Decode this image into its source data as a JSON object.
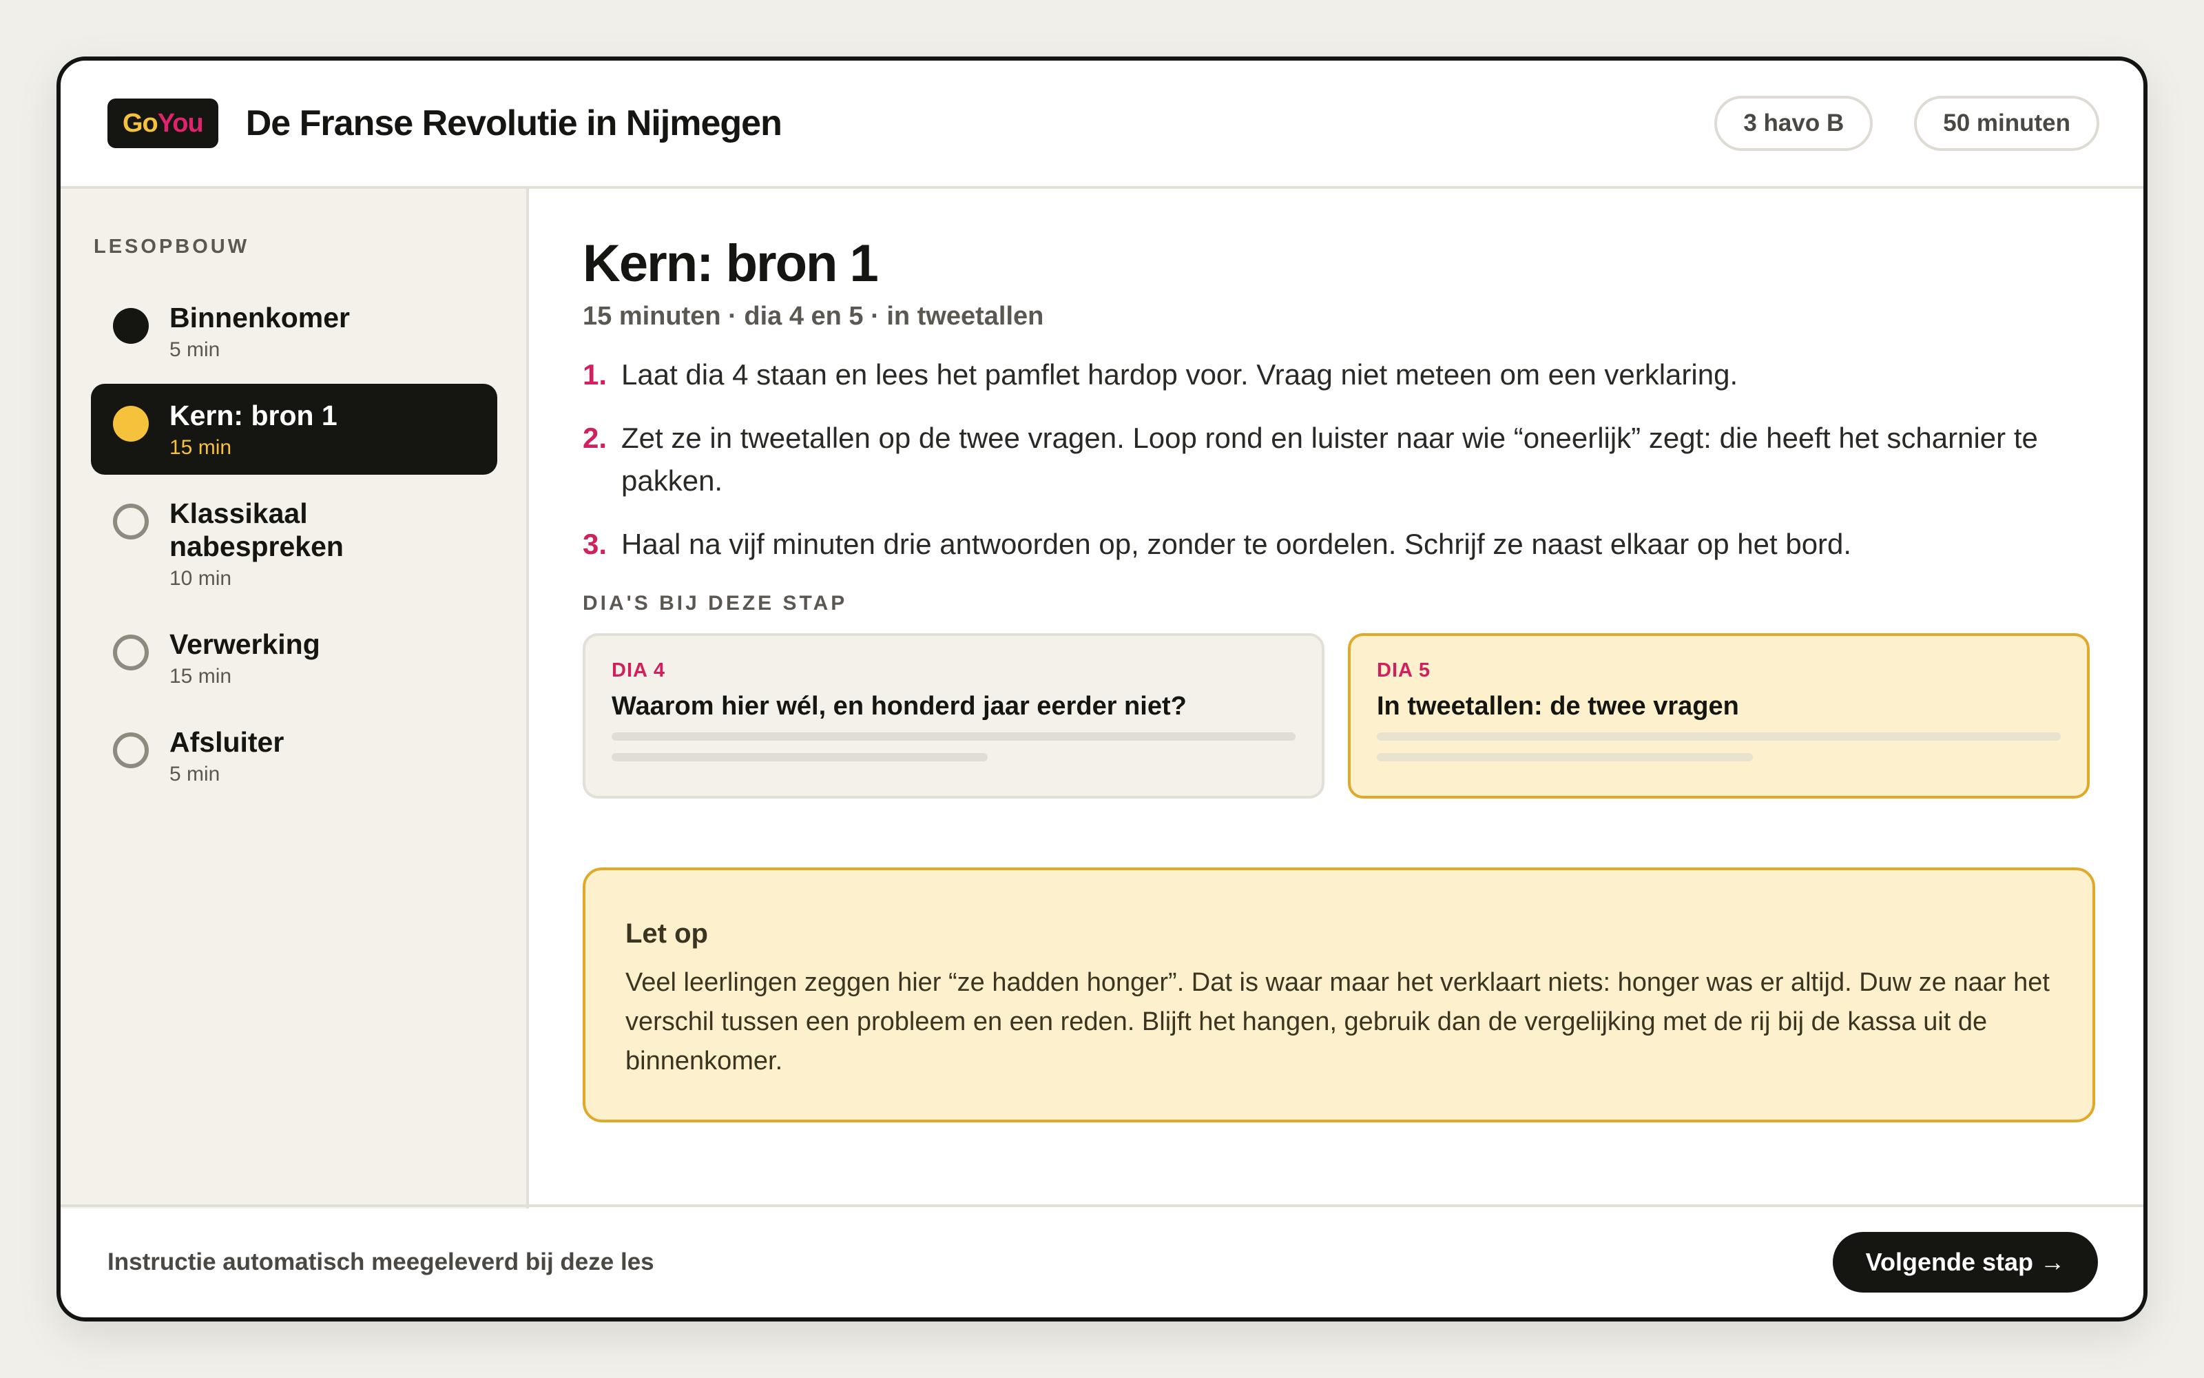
{
  "header": {
    "logo_go": "Go",
    "logo_you": "You",
    "title": "De Franse Revolutie in Nijmegen",
    "class_chip": "3 havo B",
    "duration_chip": "50 minuten"
  },
  "sidebar": {
    "heading": "LESOPBOUW",
    "steps": [
      {
        "name": "Binnenkomer",
        "time": "5 min",
        "state": "done"
      },
      {
        "name": "Kern: bron 1",
        "time": "15 min",
        "state": "current"
      },
      {
        "name": "Klassikaal nabespreken",
        "time": "10 min",
        "state": "todo"
      },
      {
        "name": "Verwerking",
        "time": "15 min",
        "state": "todo"
      },
      {
        "name": "Afsluiter",
        "time": "5 min",
        "state": "todo"
      }
    ]
  },
  "main": {
    "title": "Kern: bron 1",
    "meta": "15 minuten · dia 4 en 5 · in tweetallen",
    "instructions": [
      {
        "num": "1.",
        "text": "Laat dia 4 staan en lees het pamflet hardop voor. Vraag niet meteen om een verklaring."
      },
      {
        "num": "2.",
        "text": "Zet ze in tweetallen op de twee vragen. Loop rond en luister naar wie “oneerlijk” zegt: die heeft het scharnier te pakken."
      },
      {
        "num": "3.",
        "text": "Haal na vijf minuten drie antwoorden op, zonder te oordelen. Schrijf ze naast elkaar op het bord."
      }
    ],
    "slides_label": "DIA'S BIJ DEZE STAP",
    "slides": [
      {
        "tag": "DIA 4",
        "title": "Waarom hier wél, en honderd jaar eerder niet?"
      },
      {
        "tag": "DIA 5",
        "title": "In tweetallen: de twee vragen"
      }
    ],
    "note": {
      "title": "Let op",
      "body": "Veel leerlingen zeggen hier “ze hadden honger”. Dat is waar maar het verklaart niets: honger was er altijd. Duw ze naar het verschil tussen een probleem en een reden. Blijft het hangen, gebruik dan de vergelijking met de rij bij de kassa uit de binnenkomer."
    }
  },
  "footer": {
    "text": "Instructie automatisch meegeleverd bij deze les",
    "next_label": "Volgende stap →"
  },
  "colors": {
    "accent_yellow": "#f6c23c",
    "accent_pink": "#d0205e",
    "ink": "#151512",
    "note_bg": "#fdf0cc",
    "note_border": "#e0a92a"
  }
}
